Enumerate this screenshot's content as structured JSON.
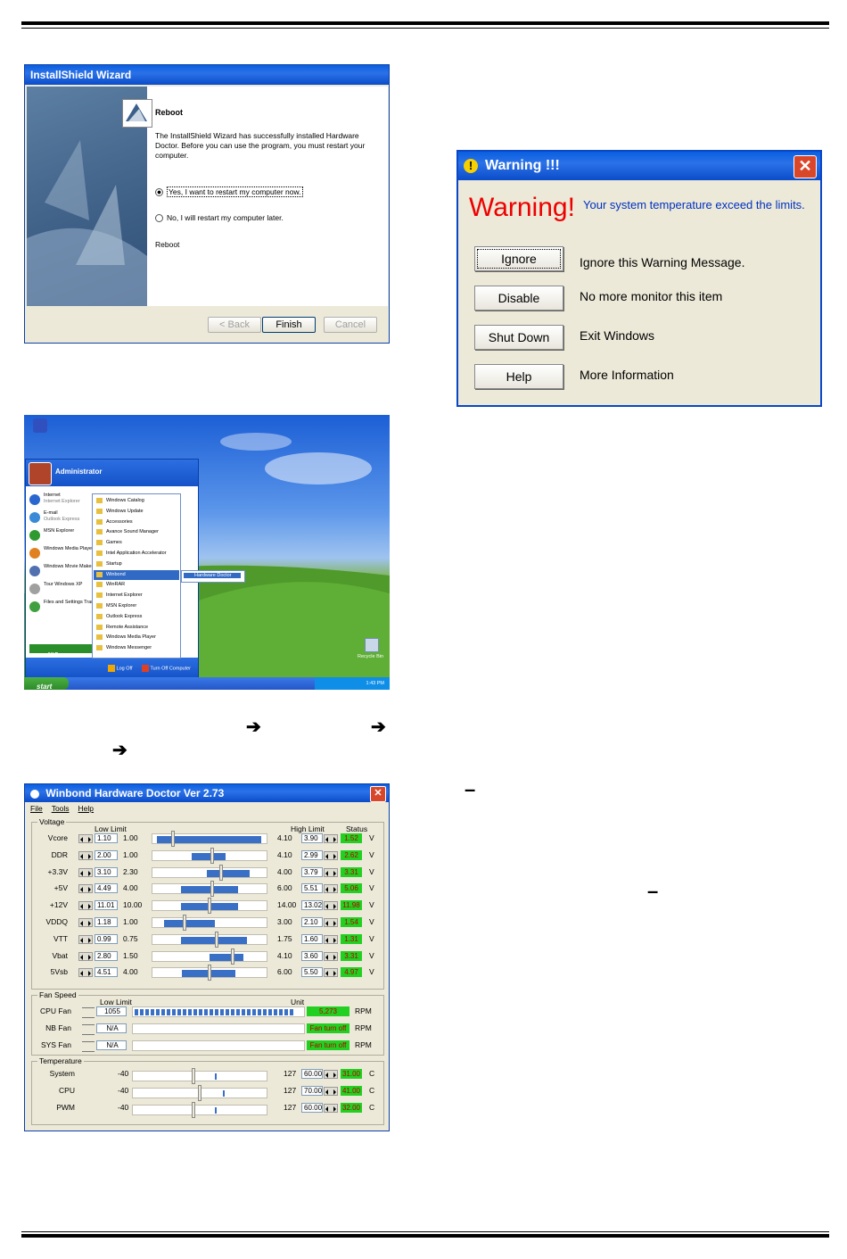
{
  "wizard": {
    "title": "InstallShield Wizard",
    "heading": "Reboot",
    "message": "The InstallShield Wizard has successfully installed Hardware Doctor.  Before you can use the program, you must restart your computer.",
    "option_yes": "Yes, I want to restart my computer now.",
    "option_no": "No, I will restart my computer later.",
    "footer_text": "Reboot",
    "back_label": "< Back",
    "finish_label": "Finish",
    "cancel_label": "Cancel"
  },
  "warning": {
    "title": "Warning !!!",
    "big_text": "Warning!",
    "message": "Your system temperature exceed the limits.",
    "buttons": [
      {
        "label": "Ignore",
        "desc": "Ignore this Warning Message."
      },
      {
        "label": "Disable",
        "desc": "No more monitor this item"
      },
      {
        "label": "Shut Down",
        "desc": "Exit Windows"
      },
      {
        "label": "Help",
        "desc": "More Information"
      }
    ]
  },
  "desktop": {
    "user": "Administrator",
    "left_items": [
      {
        "title": "Internet",
        "sub": "Internet Explorer"
      },
      {
        "title": "E-mail",
        "sub": "Outlook Express"
      },
      {
        "title": "MSN Explorer",
        "sub": ""
      },
      {
        "title": "Windows Media Player",
        "sub": ""
      },
      {
        "title": "Windows Movie Maker",
        "sub": ""
      },
      {
        "title": "Tour Windows XP",
        "sub": ""
      },
      {
        "title": "Files and Settings Transfer Wizard",
        "sub": ""
      }
    ],
    "all_programs": "All Programs",
    "programs": [
      "Windows Catalog",
      "Windows Update",
      "Accessories",
      "Avance Sound Manager",
      "Games",
      "Intel Application Accelerator",
      "Startup",
      "Winbond",
      "WinRAR",
      "Internet Explorer",
      "MSN Explorer",
      "Outlook Express",
      "Remote Assistance",
      "Windows Media Player",
      "Windows Messenger"
    ],
    "submenu_item": "Hardware Doctor",
    "log_off": "Log Off",
    "turn_off": "Turn Off Computer",
    "start": "start",
    "clock": "1:43 PM",
    "recycle_bin": "Recycle Bin"
  },
  "hwd": {
    "title": "Winbond Hardware Doctor Ver 2.73",
    "menu": [
      "File",
      "Tools",
      "Help"
    ],
    "voltage_label": "Voltage",
    "low_limit_label": "Low Limit",
    "high_limit_label": "High Limit",
    "status_label": "Status",
    "voltages": [
      {
        "name": "Vcore",
        "low": "1.10",
        "min": "1.00",
        "max": "4.10",
        "high": "3.90",
        "status": "1.52",
        "unit": "V",
        "r0": 0.04,
        "r1": 0.95,
        "t": 0.18
      },
      {
        "name": "DDR",
        "low": "2.00",
        "min": "1.00",
        "max": "4.10",
        "high": "2.99",
        "status": "2.62",
        "unit": "V",
        "r0": 0.34,
        "r1": 0.64,
        "t": 0.52
      },
      {
        "name": "+3.3V",
        "low": "3.10",
        "min": "2.30",
        "max": "4.00",
        "high": "3.79",
        "status": "3.31",
        "unit": "V",
        "r0": 0.48,
        "r1": 0.85,
        "t": 0.6
      },
      {
        "name": "+5V",
        "low": "4.49",
        "min": "4.00",
        "max": "6.00",
        "high": "5.51",
        "status": "5.06",
        "unit": "V",
        "r0": 0.25,
        "r1": 0.75,
        "t": 0.52
      },
      {
        "name": "+12V",
        "low": "11.01",
        "min": "10.00",
        "max": "14.00",
        "high": "13.02",
        "status": "11.98",
        "unit": "V",
        "r0": 0.25,
        "r1": 0.75,
        "t": 0.5
      },
      {
        "name": "VDDQ",
        "low": "1.18",
        "min": "1.00",
        "max": "3.00",
        "high": "2.10",
        "status": "1.54",
        "unit": "V",
        "r0": 0.1,
        "r1": 0.55,
        "t": 0.28
      },
      {
        "name": "VTT",
        "low": "0.99",
        "min": "0.75",
        "max": "1.75",
        "high": "1.60",
        "status": "1.31",
        "unit": "V",
        "r0": 0.25,
        "r1": 0.83,
        "t": 0.56
      },
      {
        "name": "Vbat",
        "low": "2.80",
        "min": "1.50",
        "max": "4.10",
        "high": "3.60",
        "status": "3.31",
        "unit": "V",
        "r0": 0.5,
        "r1": 0.8,
        "t": 0.7
      },
      {
        "name": "5Vsb",
        "low": "4.51",
        "min": "4.00",
        "max": "6.00",
        "high": "5.50",
        "status": "4.97",
        "unit": "V",
        "r0": 0.26,
        "r1": 0.73,
        "t": 0.5
      }
    ],
    "fan_label": "Fan Speed",
    "fan_low_label": "Low Limit",
    "fan_unit_label": "Unit",
    "fans": [
      {
        "name": "CPU Fan",
        "low": "1055",
        "status": "5,273",
        "unit": "RPM",
        "level": 1.0
      },
      {
        "name": "NB Fan",
        "low": "N/A",
        "status": "Fan turn off",
        "unit": "RPM",
        "level": 0
      },
      {
        "name": "SYS Fan",
        "low": "N/A",
        "status": "Fan turn off",
        "unit": "RPM",
        "level": 0
      }
    ],
    "temp_label": "Temperature",
    "temps": [
      {
        "name": "System",
        "min": "-40",
        "max": "127",
        "limit": "60.00",
        "status": "31.00",
        "unit": "C",
        "t": 0.45,
        "v": 0.61
      },
      {
        "name": "CPU",
        "min": "-40",
        "max": "127",
        "limit": "70.00",
        "status": "41.00",
        "unit": "C",
        "t": 0.5,
        "v": 0.67
      },
      {
        "name": "PWM",
        "min": "-40",
        "max": "127",
        "limit": "60.00",
        "status": "32.00",
        "unit": "C",
        "t": 0.45,
        "v": 0.61
      }
    ]
  },
  "text_marks": {
    "arrow1": "➔",
    "arrow2": "➔",
    "arrow3": "➔",
    "dash1": "–",
    "dash2": "–"
  }
}
